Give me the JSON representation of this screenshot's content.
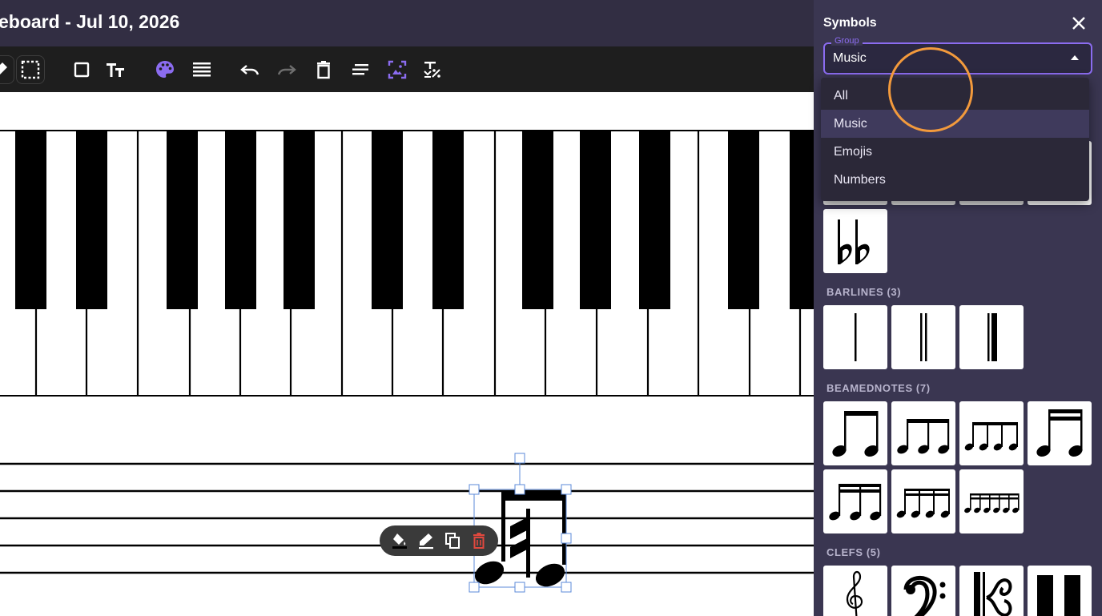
{
  "header": {
    "title": "eboard - Jul 10, 2026"
  },
  "toolbar": {
    "tools": [
      {
        "name": "pen-icon"
      },
      {
        "name": "select-region-icon"
      },
      {
        "name": "rectangle-icon"
      },
      {
        "name": "text-size-icon"
      },
      {
        "name": "palette-icon"
      },
      {
        "name": "line-weight-icon"
      },
      {
        "name": "undo-icon"
      },
      {
        "name": "redo-icon"
      },
      {
        "name": "delete-icon"
      },
      {
        "name": "align-icon"
      },
      {
        "name": "image-fit-icon"
      },
      {
        "name": "transform-icon"
      }
    ],
    "accent": "#8b6cf0"
  },
  "mini_toolbar": {
    "tools": [
      "fill-icon",
      "pencil-icon",
      "duplicate-icon",
      "trash-icon"
    ],
    "trash_color": "#e0483e"
  },
  "panel": {
    "title": "Symbols",
    "group_label": "Group",
    "group_value": "Music",
    "menu_options": [
      "All",
      "Music",
      "Emojis",
      "Numbers"
    ],
    "selected_option": "Music",
    "sections": [
      {
        "label": "BARLINES (3)"
      },
      {
        "label": "BEAMEDNOTES (7)"
      },
      {
        "label": "CLEFS (5)"
      }
    ]
  },
  "colors": {
    "panel_bg": "#3a3651",
    "header_bg": "#322e43",
    "toolbar_bg": "#1e1e1e",
    "accent": "#8b6cf0",
    "cursor_ring": "#f39a3c"
  }
}
